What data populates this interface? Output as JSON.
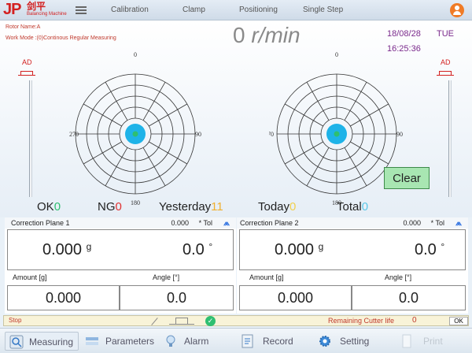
{
  "header": {
    "logo_text": "JP",
    "logo_cn": "剑平",
    "logo_sub": "Balancing Machine",
    "nav": [
      "Calibration",
      "Clamp",
      "Positioning",
      "Single Step"
    ]
  },
  "info": {
    "rotor_name": "Rotor Name:A",
    "work_mode": "Work Mode :(0)Continous Regular Measuring",
    "speed_value": "0",
    "speed_unit": "r/min",
    "date": "18/08/28",
    "day": "TUE",
    "time": "16:25:36"
  },
  "ad_label": "AD",
  "polar_labels": {
    "top": "0",
    "right": "90",
    "bottom": "180",
    "left": "270"
  },
  "clear_label": "Clear",
  "counts": {
    "ok_label": "OK",
    "ok_value": "0",
    "ng_label": "NG",
    "ng_value": "0",
    "yesterday_label": "Yesterday",
    "yesterday_value": "11",
    "today_label": "Today",
    "today_value": "0",
    "total_label": "Total",
    "total_value": "0"
  },
  "planes": [
    {
      "title": "Correction Plane 1",
      "tol": "0.000",
      "tol_label": "* Tol",
      "amount": "0.000",
      "amount_unit": "g",
      "angle": "0.0",
      "angle_unit": "°",
      "amount_header": "Amount [g]",
      "angle_header": "Angle  [°]",
      "sub_amount": "0.000",
      "sub_angle": "0.0"
    },
    {
      "title": "Correction Plane 2",
      "tol": "0.000",
      "tol_label": "* Tol",
      "amount": "0.000",
      "amount_unit": "g",
      "angle": "0.0",
      "angle_unit": "°",
      "amount_header": "Amount [g]",
      "angle_header": "Angle  [°]",
      "sub_amount": "0.000",
      "sub_angle": "0.0"
    }
  ],
  "status": {
    "state": "Stop",
    "cutter_label": "Remaining Cutter life",
    "cutter_value": "0",
    "ok_button": "OK"
  },
  "bottom_tabs": [
    {
      "label": "Measuring",
      "icon": "search-icon"
    },
    {
      "label": "Parameters",
      "icon": "parameters-icon"
    },
    {
      "label": "Alarm",
      "icon": "bulb-icon"
    },
    {
      "label": "Record",
      "icon": "record-icon"
    },
    {
      "label": "Setting",
      "icon": "gear-icon"
    },
    {
      "label": "Print",
      "icon": "print-icon"
    }
  ],
  "colors": {
    "accent": "#f07b26",
    "ok_green": "#2fbf71",
    "ng_red": "#e03030",
    "dial_center": "#1eb3e8"
  }
}
